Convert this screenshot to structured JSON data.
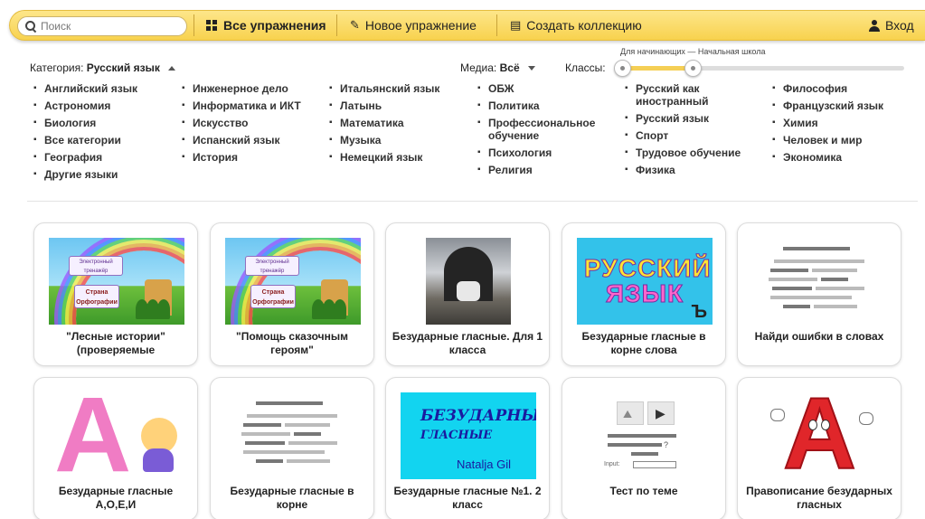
{
  "search": {
    "placeholder": "Поиск"
  },
  "nav": {
    "all_exercises": "Все упражнения",
    "new_exercise": "Новое упражнение",
    "create_collection": "Создать коллекцию",
    "login": "Вход"
  },
  "filters": {
    "category_label": "Категория:",
    "category_value": "Русский язык",
    "media_label": "Медиа:",
    "media_value": "Всё",
    "classes_label": "Классы:",
    "slider_caption": "Для начинающих — Начальная школа",
    "slider_range": {
      "from": 0.0,
      "to": 0.25
    }
  },
  "categories": [
    [
      "Английский язык",
      "Астрономия",
      "Биология",
      "Все категории",
      "География",
      "Другие языки"
    ],
    [
      "Инженерное дело",
      "Информатика и ИКТ",
      "Искусство",
      "Испанский язык",
      "История"
    ],
    [
      "Итальянский язык",
      "Латынь",
      "Математика",
      "Музыка",
      "Немецкий язык"
    ],
    [
      "ОБЖ",
      "Политика",
      "Профессиональное обучение",
      "Психология",
      "Религия"
    ],
    [
      "Русский как иностранный",
      "Русский язык",
      "Спорт",
      "Трудовое обучение",
      "Физика"
    ],
    [
      "Философия",
      "Французский язык",
      "Химия",
      "Человек и мир",
      "Экономика"
    ]
  ],
  "cards": [
    {
      "title": "\"Лесные истории\" (проверяемые",
      "thumb": "rainbow",
      "thumb_text": [
        "Электронный тренажёр",
        "Страна Орфографии"
      ]
    },
    {
      "title": "\"Помощь сказочным героям\"",
      "thumb": "rainbow",
      "thumb_text": [
        "Электронный тренажёр",
        "Страна Орфографии"
      ]
    },
    {
      "title": "Безударные гласные. Для 1 класса",
      "thumb": "photo"
    },
    {
      "title": "Безударные гласные в корне слова",
      "thumb": "russian",
      "thumb_text": [
        "РУССКИЙ",
        "ЯЗЫК",
        "Ъ"
      ]
    },
    {
      "title": "Найди ошибки в словах",
      "thumb": "lines-icon"
    },
    {
      "title": "Безударные гласные А,О,Е,И",
      "thumb": "big-a-pink",
      "thumb_text": [
        "А"
      ]
    },
    {
      "title": "Безударные гласные в корне",
      "thumb": "lines-icon"
    },
    {
      "title": "Безударные гласные №1. 2 класс",
      "thumb": "cyan-text",
      "thumb_text": [
        "БЕЗУДАРНЫЕ",
        "ГЛАСНЫЕ",
        "Natalja Gil"
      ]
    },
    {
      "title": "Тест по теме",
      "thumb": "test-icon",
      "thumb_text": [
        "Input:",
        "?"
      ]
    },
    {
      "title": "Правописание безударных гласных",
      "thumb": "big-a-red",
      "thumb_text": [
        "А"
      ]
    }
  ],
  "colors": {
    "topbar": "#f8d24e",
    "slider_fill": "#f5cf55",
    "card_border": "#dcdcdc"
  },
  "icons": {
    "search": "search-icon",
    "all_exercises": "grid-icon",
    "new_exercise": "pencil-icon",
    "create_collection": "collection-icon",
    "login": "user-icon"
  }
}
